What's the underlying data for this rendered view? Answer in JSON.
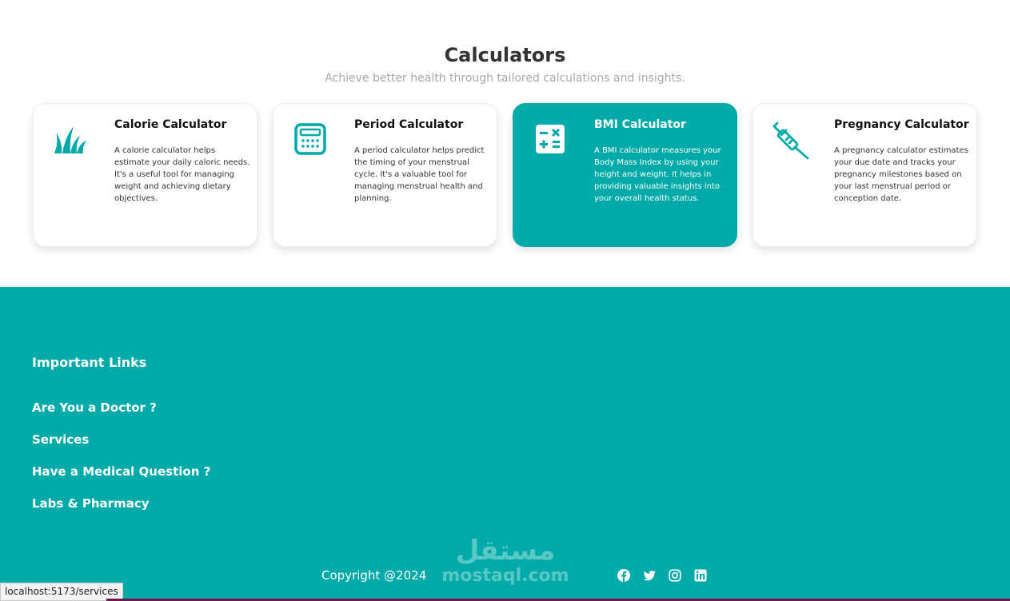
{
  "section": {
    "title": "Calculators",
    "subtitle": "Achieve better health through tailored calculations and insights."
  },
  "cards": [
    {
      "title": "Calorie Calculator",
      "description": "A calorie calculator helps estimate your daily caloric needs. It's a useful tool for managing weight and achieving dietary objectives.",
      "icon": "grass-icon",
      "active": false
    },
    {
      "title": "Period Calculator",
      "description": "A period calculator helps predict the timing of your menstrual cycle. It's a valuable tool for managing menstrual health and planning.",
      "icon": "calculator-icon",
      "active": false
    },
    {
      "title": "BMI Calculator",
      "description": "A BMI calculator measures your Body Mass Index by using your height and weight. It helps in providing valuable insights into your overall health status.",
      "icon": "math-operations-icon",
      "active": true
    },
    {
      "title": "Pregnancy Calculator",
      "description": "A pregnancy calculator estimates your due date and tracks your pregnancy milestones based on your last menstrual period or conception date.",
      "icon": "syringe-icon",
      "active": false
    }
  ],
  "footer": {
    "heading": "Important Links",
    "links": [
      "Are You a Doctor ?",
      "Services",
      "Have a Medical Question ?",
      "Labs & Pharmacy"
    ],
    "copyright": "Copyright @2024",
    "social": [
      "facebook-icon",
      "twitter-icon",
      "instagram-icon",
      "linkedin-icon"
    ]
  },
  "watermark": {
    "arabic": "مستقل",
    "latin": "mostaql.com"
  },
  "status_url": "localhost:5173/services",
  "colors": {
    "accent": "#00aaa8",
    "title": "#333333",
    "subtitle": "#a8a8a8"
  }
}
